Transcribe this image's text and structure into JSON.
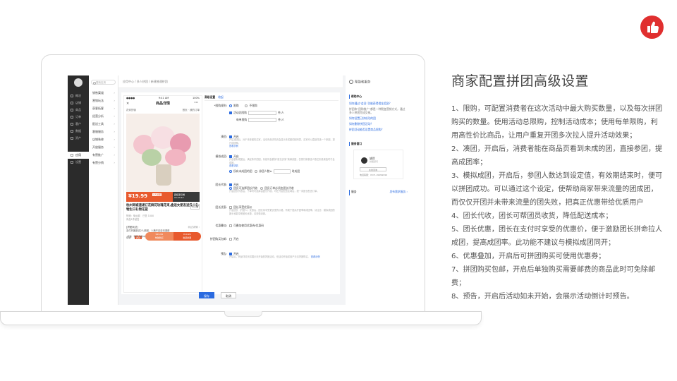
{
  "slide": {
    "title": "商家配置拼团高级设置",
    "points": [
      "1、限购，可配置消费者在这次活动中最大购买数量，以及每次拼团购买的数量。使用活动总限购，控制活动成本；使用每单限购，利用高性价比商品，让用户重复开团多次拉人提升活动效果；",
      "2、凑团，开启后，消费者能在商品页看到未成的团，直接参团，提高成团率；",
      "3、模拟成团，开启后，参团人数达到设定值，有效期结束时，便可以拼团成功。可以通过这个设定，使帮助商家带来流量的团成团，而仅仅开团并未带来流量的团失败，把真正优惠带给优质用户",
      "4、团长代收，团长可帮团员收货，降低配送成本；",
      "5、团长优惠，团长在支付时享受的优惠价，便于激励团长拼命拉人成团，提高成团率。此功能不建议与模拟成团同开；",
      "6、优惠叠加，开启后可拼团购买可使用优惠券；",
      "7、拼团购买包邮，开启后单独购买需要邮费的商品此时可免除邮费；",
      "8、预告，开启后活动如未开始，会展示活动倒计时预告。"
    ],
    "accent": "#e02f2f"
  },
  "nav": {
    "items": [
      "概况",
      "店铺",
      "商品",
      "订单",
      "客户",
      "数据",
      "资产",
      "应用",
      "设置"
    ],
    "active_index": 7
  },
  "subnav": {
    "search_placeholder": "搜索应用",
    "items": [
      "销售渠道",
      "营销玩法",
      "获客拓客",
      "经营分析",
      "配送工具",
      "客服服务",
      "店铺装修",
      "开放服务",
      "有赞推广",
      "有赞分销"
    ]
  },
  "breadcrumb": "应用中心 / 多人拼团 / 新建普通拼团",
  "phone": {
    "time": "9:41 AM",
    "battery": "100%",
    "title": "商品详情",
    "shop_name": "花你的街",
    "shop_right": "首页 · 我的订单",
    "price": "¥19.99",
    "price_tag": "2人拼团",
    "countdown_label": "距结束仅剩",
    "countdown": "15:23:12",
    "product_title": "杭州同城速递订花鲜花玫瑰花束,盒送女朋友送爱人礼物生日礼物花篮",
    "badge": "分享赚",
    "sales": "已售 1000",
    "shipping": "快递：免运费",
    "sub_note": "商品1件起售",
    "group_title": "[拼团玩法]",
    "group_right": "玩法详情 ›",
    "group_desc": "支付开团邀请2人参团，人满不足自动退款",
    "promo_label": "促销",
    "promo_tag": "满减",
    "promo_text": "满100减10",
    "foot_shop": "店铺",
    "foot_cs": "客服",
    "foot_cart": "购物车",
    "btn_single_price": "¥29.99",
    "btn_single": "单独购买",
    "btn_group_price": "¥19.99",
    "btn_group": "发起拼团"
  },
  "form": {
    "header_tab": "高级设置",
    "header_link": "收起",
    "limit_label": "*限购规则:",
    "limit_opt1": "限购",
    "limit_opt2": "不限购",
    "total_limit": "活动总限购",
    "per_person": "件/人",
    "per_order_label": "每单限购",
    "per_order_unit": "件/人",
    "join_label": "凑团:",
    "join_on": "开启",
    "join_hint": "开启凑团后，对于未参团的买家，活动商品详情页会显示未成团的团列表，买家可以直接任选一个参团，提升成团率。",
    "join_link": "查看示例",
    "sim_label": "模拟成团:",
    "sim_on": "开启",
    "sim_hint": "开启模拟成团后，满足条件的团，系统将会模拟\"匿名买家\"凑满该团，仅需付款参团人数达到设置值时才会成团。",
    "sim_link": "查看详情",
    "sim_opt1": "所有未成团的团",
    "sim_opt2": "参团人数≥",
    "sim_unit": "时成团",
    "agent_label": "团长代收:",
    "agent_on": "开启",
    "agent_opt1": "团员可选择团长代收",
    "agent_opt2": "团员订单必须由团长代收",
    "agent_hint": "开启团长代收后，下单时可选择由团长代收。可在开启配送区域后，统一向团长配送订单。",
    "leader_label": "团长优惠:",
    "leader_opt": "团长享受优惠价",
    "leader_hint": "开启团长（开团人）优惠后，团长将享受更优惠的价格，有助于提高开团率和成团率。请注意：模拟成团的团长也能享受团长优惠，请谨慎设置。",
    "stack_label": "优惠叠加:",
    "stack_opt": "可叠加使用优惠券/优惠码",
    "ship_label": "拼团购买包邮:",
    "ship_opt": "开启",
    "notice_label": "预告:",
    "notice_on": "开启",
    "notice_hint": "开启后，商品详情页将展示未开始的拼团活动，但活动开始前用户无法拼团购买。",
    "notice_link": "查看示例",
    "save": "保存",
    "cancel": "取消"
  },
  "help": {
    "title": "帮助和服务",
    "sec1": "帮助中心",
    "q1": "如何通过\"会员\"功能获得佣金奖励？",
    "t1": "拼团和\"团购推广\"都是一种裂变营销方式，通过多人拼团完成交易。",
    "q2": "如何设置已拼成功的团",
    "q3": "如何删除拼团活动？",
    "q4": "拼团活动能否设置商品限购？",
    "sec2": "服务窗口",
    "agent_name": "姚然",
    "agent_role": "拼团顾问",
    "consult": "在线咨询",
    "phone_label": "电话客服",
    "phone": "0571-99999999",
    "sec3": "服务",
    "service_link": "发布需求服务 ›"
  }
}
